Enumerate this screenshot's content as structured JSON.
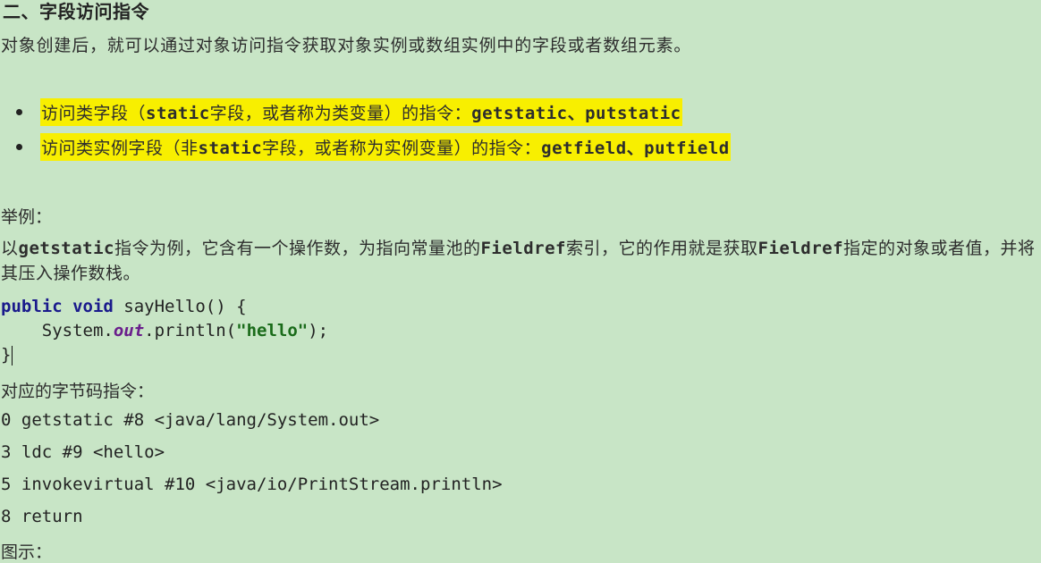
{
  "heading": "二、字段访问指令",
  "intro": "对象创建后，就可以通过对象访问指令获取对象实例或数组实例中的字段或者数组元素。",
  "bullets": [
    {
      "p1": "访问类字段（",
      "code1": "static",
      "p2": "字段，或者称为类变量）的指令：",
      "code2": "getstatic、putstatic"
    },
    {
      "p1": "访问类实例字段（非",
      "code1": "static",
      "p2": "字段，或者称为实例变量）的指令：",
      "code2": "getfield、putfield"
    }
  ],
  "example_label": "举例：",
  "description": {
    "p1": "以",
    "c1": "getstatic",
    "p2": "指令为例，它含有一个操作数，为指向常量池的",
    "c2": "Fieldref",
    "p3": "索引，它的作用就是获取",
    "c3": "Fieldref",
    "p4": "指定的对象或者值，并将其压入操作数栈。"
  },
  "code": {
    "kw_public": "public",
    "kw_void": "void",
    "method_sig": " sayHello() {",
    "indent": "    ",
    "system": "System.",
    "out": "out",
    "println_open": ".println(",
    "string": "\"hello\"",
    "println_close": ");",
    "closing": "}"
  },
  "bytecode_label": "对应的字节码指令：",
  "bytecode": [
    "0 getstatic #8 <java/lang/System.out>",
    "3 ldc #9 <hello>",
    "5 invokevirtual #10 <java/io/PrintStream.println>",
    "8 return"
  ],
  "figure_label": "图示："
}
